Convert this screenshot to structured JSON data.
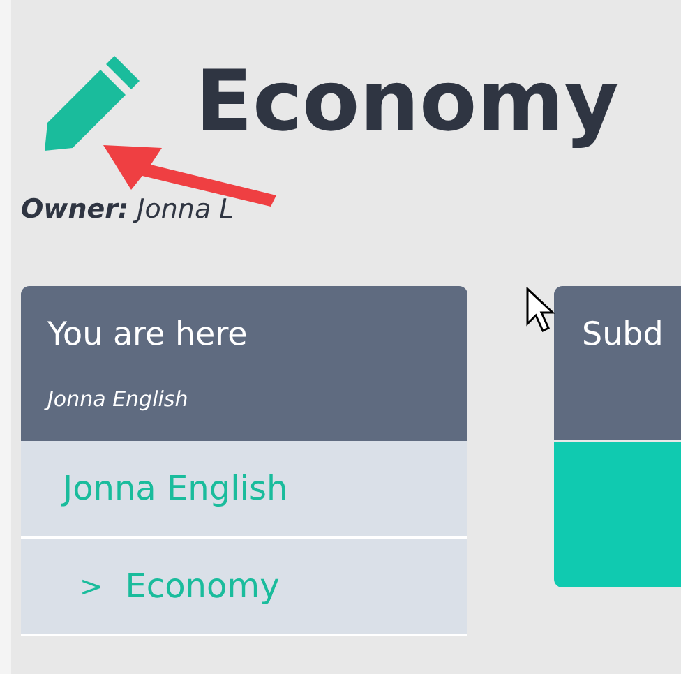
{
  "page": {
    "title": "Economy",
    "owner_label": "Owner:",
    "owner": "Jonna L"
  },
  "breadcrumb_panel": {
    "title": "You are here",
    "subtitle": "Jonna English",
    "items": [
      {
        "label": "Jonna English",
        "children": [
          {
            "label": "Economy",
            "marker": ">"
          }
        ]
      }
    ]
  },
  "subdivision_panel": {
    "title": "Subd"
  }
}
